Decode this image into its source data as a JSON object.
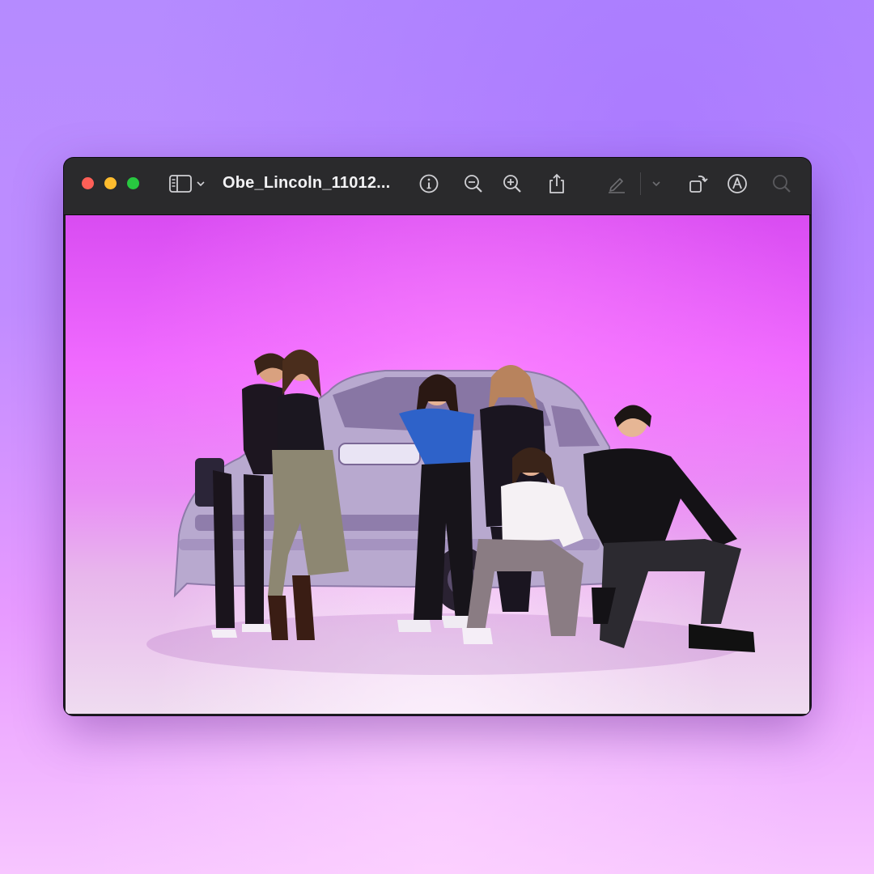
{
  "window": {
    "title": "Obe_Lincoln_11012...",
    "toolbar": {
      "sidebar_toggle_icon": "sidebar-icon",
      "info_icon": "info-icon",
      "zoom_out_icon": "zoom-out-icon",
      "zoom_in_icon": "zoom-in-icon",
      "share_icon": "share-icon",
      "markup_pen_icon": "pen-icon",
      "rotate_icon": "rotate-icon",
      "annotate_icon": "annotate-icon",
      "search_icon": "search-icon"
    },
    "traffic_lights": [
      "#ff5f57",
      "#febc2e",
      "#28c840"
    ]
  },
  "image": {
    "subject": "photo",
    "background_colors": [
      "#d94cf2",
      "#f06aff",
      "#efdcf0"
    ]
  }
}
